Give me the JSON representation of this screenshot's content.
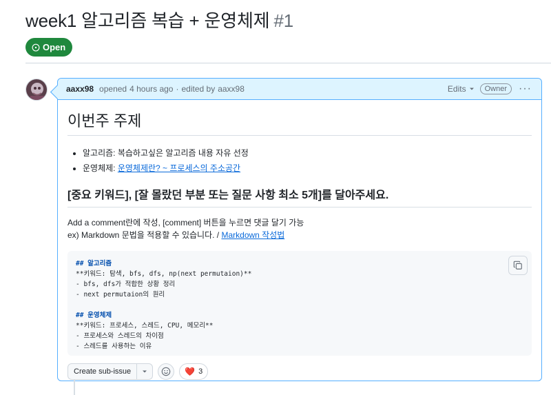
{
  "issue": {
    "title": "week1 알고리즘 복습 + 운영체제",
    "number": "#1",
    "state": "Open"
  },
  "comment": {
    "author": "aaxx98",
    "action": "opened",
    "time": "4 hours ago",
    "edited_separator": "·",
    "edited_by_label": "edited by",
    "edited_by": "aaxx98",
    "edits_label": "Edits",
    "owner_badge": "Owner",
    "more_icon": "kebab-horizontal-icon",
    "body": {
      "h1": "이번주 주제",
      "bullets": [
        {
          "text": "알고리즘: 복습하고싶은 알고리즘 내용 자유 선정",
          "link": ""
        },
        {
          "text": "운영체제: ",
          "link": "운영체제란? ~ 프로세스의 주소공간"
        }
      ],
      "h2": "[중요 키워드], [잘 몰랐던 부분 또는 질문 사항 최소 5개]를 달아주세요.",
      "p1": "Add a comment란에 작성, [comment] 버튼을 누르면 댓글 달기 가능",
      "p2_text": "ex) Markdown 문법을 적용할 수 있습니다. / ",
      "p2_link": "Markdown 작성법",
      "code_lines": [
        "## 알고리즘",
        "**키워드: 탐색, bfs, dfs, np(next permutaion)**",
        "- bfs, dfs가 적합한 상황 정리",
        "- next permutaion의 원리",
        "",
        "## 운영체제",
        "**키워드: 프로세스, 스레드, CPU, 메모리**",
        "- 프로세스와 스레드의 차이점",
        "- 스레드를 사용하는 이유"
      ]
    },
    "footer": {
      "create_sub_issue": "Create sub-issue",
      "reaction_emoji": "❤️",
      "reaction_count": "3"
    }
  },
  "colors": {
    "open_green": "#1f883d",
    "header_blue": "#ddf4ff",
    "border_blue": "#54aeff",
    "link": "#0969da"
  }
}
